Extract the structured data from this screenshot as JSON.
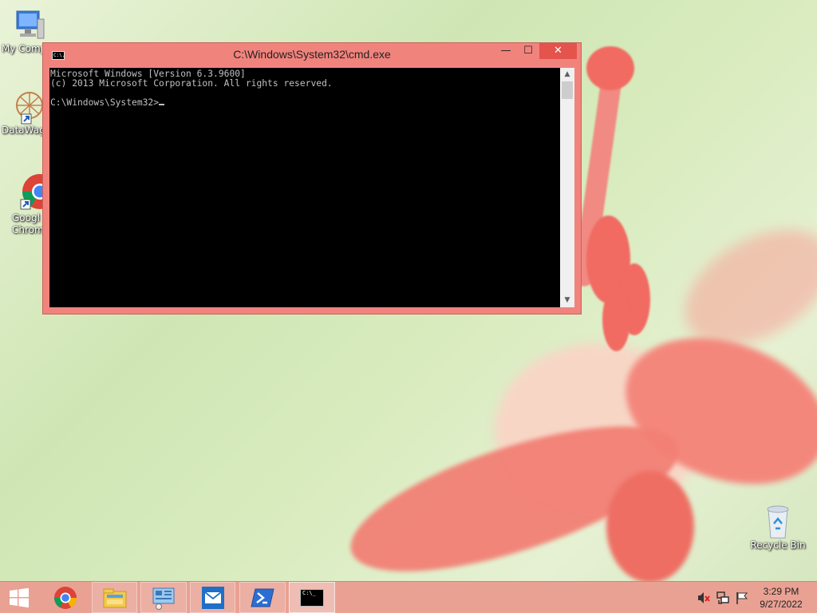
{
  "desktop": {
    "icons": [
      {
        "label": "My Comp",
        "icon": "computer-icon"
      },
      {
        "label": "DataWag",
        "icon": "datawagon-shortcut-icon"
      },
      {
        "label": "Googl\nChrom",
        "icon": "chrome-shortcut-icon"
      },
      {
        "label": "Recycle Bin",
        "icon": "recycle-bin-icon"
      }
    ]
  },
  "window": {
    "title": "C:\\Windows\\System32\\cmd.exe",
    "app_icon_text": "C:\\.",
    "min_label": "—",
    "max_label": "☐",
    "close_label": "✕",
    "console_lines": [
      "Microsoft Windows [Version 6.3.9600]",
      "(c) 2013 Microsoft Corporation. All rights reserved.",
      "",
      "C:\\Windows\\System32>"
    ],
    "scroll_up": "▲",
    "scroll_down": "▼"
  },
  "taskbar": {
    "items": [
      "start-icon",
      "chrome-icon",
      "file-explorer-icon",
      "control-panel-icon",
      "mail-icon",
      "powershell-icon",
      "cmd-icon"
    ],
    "cmd_icon_text": "C:\\_",
    "tray": [
      "volume-muted-icon",
      "network-icon",
      "action-center-flag-icon"
    ],
    "time": "3:29 PM",
    "date": "9/27/2022"
  },
  "colors": {
    "window_frame": "#f1837d",
    "close_button": "#e4534c",
    "taskbar": "#e9a193",
    "console_bg": "#000000",
    "console_text": "#c0c0c0"
  }
}
